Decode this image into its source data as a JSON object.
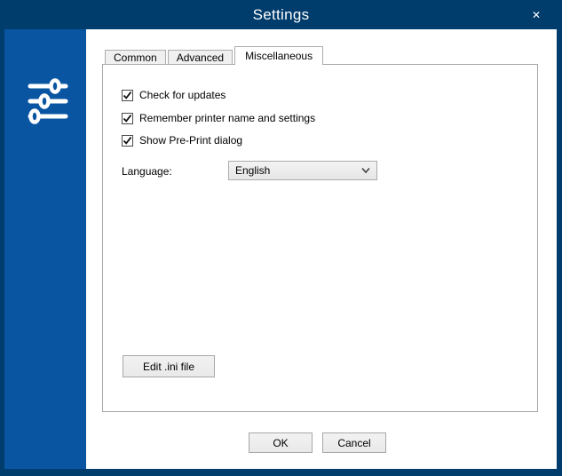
{
  "window": {
    "title": "Settings",
    "close_glyph": "✕"
  },
  "tabs": [
    {
      "label": "Common",
      "active": false
    },
    {
      "label": "Advanced",
      "active": false
    },
    {
      "label": "Miscellaneous",
      "active": true
    }
  ],
  "panel": {
    "checkboxes": [
      {
        "label": "Check for updates",
        "checked": true
      },
      {
        "label": "Remember printer name and settings",
        "checked": true
      },
      {
        "label": "Show Pre-Print dialog",
        "checked": true
      }
    ],
    "language": {
      "label": "Language:",
      "selected": "English"
    },
    "edit_ini_label": "Edit .ini file"
  },
  "dialog_buttons": {
    "ok": "OK",
    "cancel": "Cancel"
  },
  "icons": {
    "sidebar": "sliders-icon",
    "close": "close-icon",
    "checkbox": "check-icon",
    "dropdown": "chevron-down-icon"
  },
  "colors": {
    "titlebar": "#003c6c",
    "sidebar": "#0a55a2",
    "content_bg": "#ffffff",
    "tab_inactive_bg": "#f0f0f0",
    "control_border": "#acacac",
    "panel_border": "#a7a7a7",
    "button_bg": "#eeeeee",
    "text": "#000000",
    "title_text": "#ffffff"
  }
}
